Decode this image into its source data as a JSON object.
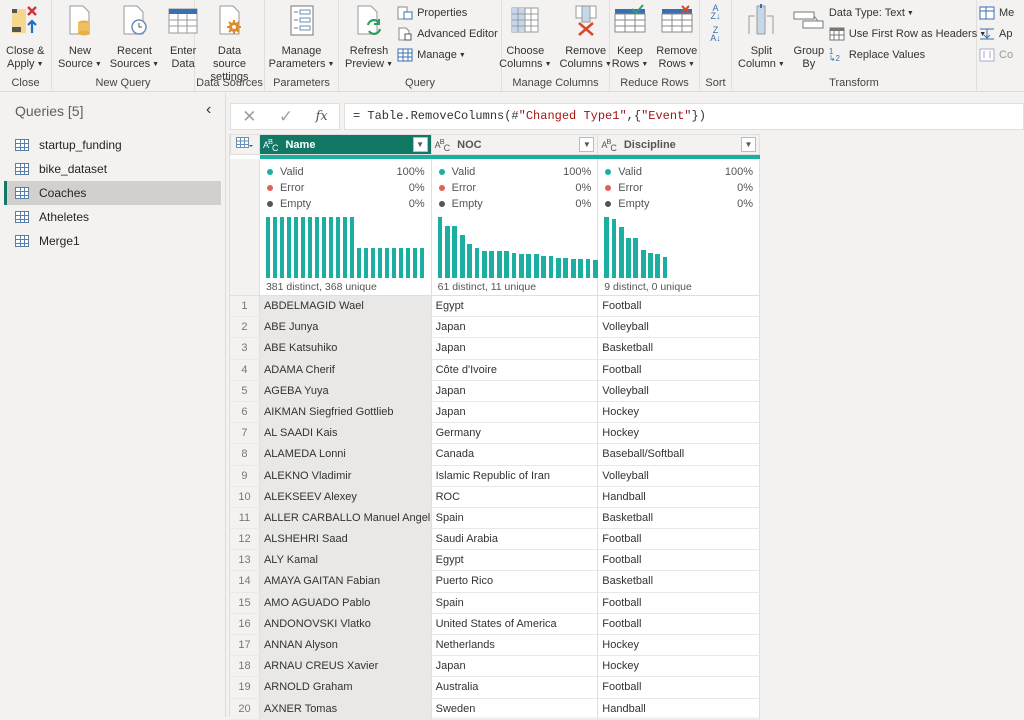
{
  "ribbon": {
    "groups": [
      {
        "label": "Close",
        "buttons": [
          {
            "label1": "Close &",
            "label2": "Apply",
            "caret": true
          }
        ]
      },
      {
        "label": "New Query",
        "buttons": [
          {
            "label1": "New",
            "label2": "Source",
            "caret": true
          },
          {
            "label1": "Recent",
            "label2": "Sources",
            "caret": true
          },
          {
            "label1": "Enter",
            "label2": "Data",
            "caret": false
          }
        ]
      },
      {
        "label": "Data Sources",
        "buttons": [
          {
            "label1": "Data source",
            "label2": "settings",
            "caret": false
          }
        ]
      },
      {
        "label": "Parameters",
        "buttons": [
          {
            "label1": "Manage",
            "label2": "Parameters",
            "caret": true
          }
        ]
      },
      {
        "label": "Query",
        "buttons": [
          {
            "label1": "Refresh",
            "label2": "Preview",
            "caret": true
          }
        ],
        "small": [
          {
            "label": "Properties"
          },
          {
            "label": "Advanced Editor"
          },
          {
            "label": "Manage",
            "caret": true
          }
        ]
      },
      {
        "label": "Manage Columns",
        "buttons": [
          {
            "label1": "Choose",
            "label2": "Columns",
            "caret": true
          },
          {
            "label1": "Remove",
            "label2": "Columns",
            "caret": true
          }
        ]
      },
      {
        "label": "Reduce Rows",
        "buttons": [
          {
            "label1": "Keep",
            "label2": "Rows",
            "caret": true
          },
          {
            "label1": "Remove",
            "label2": "Rows",
            "caret": true
          }
        ]
      },
      {
        "label": "Sort",
        "small": [
          {
            "label": "Sort Ascending"
          },
          {
            "label": "Sort Descending"
          }
        ]
      },
      {
        "label": "Transform",
        "buttons": [
          {
            "label1": "Split",
            "label2": "Column",
            "caret": true
          },
          {
            "label1": "Group",
            "label2": "By",
            "caret": false
          }
        ],
        "small": [
          {
            "label": "Data Type: Text",
            "caret": true
          },
          {
            "label": "Use First Row as Headers",
            "caret": true
          },
          {
            "label": "Replace Values"
          }
        ]
      },
      {
        "label": "",
        "small": [
          {
            "label": "Me"
          },
          {
            "label": "Ap"
          },
          {
            "label": "Co"
          }
        ]
      }
    ]
  },
  "queries": {
    "title": "Queries [5]",
    "items": [
      {
        "label": "startup_funding",
        "selected": false
      },
      {
        "label": "bike_dataset",
        "selected": false
      },
      {
        "label": "Coaches",
        "selected": true
      },
      {
        "label": "Atheletes",
        "selected": false
      },
      {
        "label": "Merge1",
        "selected": false
      }
    ]
  },
  "formula": {
    "cancel_icon": "✕",
    "commit_icon": "✓",
    "fx_label": "fx",
    "prefix": "= Table.RemoveColumns(#",
    "s1": "\"Changed Type1\"",
    "mid": ",{",
    "s2": "\"Event\"",
    "suffix": "})"
  },
  "columns": [
    {
      "name": "Name",
      "type": "ABC",
      "selected": true,
      "valid": "100%",
      "error": "0%",
      "empty": "0%",
      "distinct": "381 distinct, 368 unique"
    },
    {
      "name": "NOC",
      "type": "ABC",
      "selected": false,
      "valid": "100%",
      "error": "0%",
      "empty": "0%",
      "distinct": "61 distinct, 11 unique"
    },
    {
      "name": "Discipline",
      "type": "ABC",
      "selected": false,
      "valid": "100%",
      "error": "0%",
      "empty": "0%",
      "distinct": "9 distinct, 0 unique"
    }
  ],
  "quality_labels": {
    "valid": "Valid",
    "error": "Error",
    "empty": "Empty"
  },
  "colors": {
    "valid": "#1aafa0",
    "error": "#e0605a",
    "empty": "#555555",
    "accent": "#117865"
  },
  "histograms": [
    [
      2,
      2,
      2,
      2,
      2,
      2,
      2,
      2,
      2,
      2,
      2,
      2,
      2,
      1,
      1,
      1,
      1,
      1,
      1,
      1,
      1,
      1,
      1
    ],
    [
      100,
      85,
      85,
      70,
      55,
      49,
      44,
      44,
      44,
      44,
      41,
      39,
      39,
      39,
      36,
      36,
      33,
      33,
      31,
      31,
      31,
      29
    ],
    [
      100,
      96,
      83,
      66,
      66,
      46,
      41,
      40,
      35
    ]
  ],
  "rows": [
    [
      "1",
      "ABDELMAGID Wael",
      "Egypt",
      "Football"
    ],
    [
      "2",
      "ABE Junya",
      "Japan",
      "Volleyball"
    ],
    [
      "3",
      "ABE Katsuhiko",
      "Japan",
      "Basketball"
    ],
    [
      "4",
      "ADAMA Cherif",
      "Côte d'Ivoire",
      "Football"
    ],
    [
      "5",
      "AGEBA Yuya",
      "Japan",
      "Volleyball"
    ],
    [
      "6",
      "AIKMAN Siegfried Gottlieb",
      "Japan",
      "Hockey"
    ],
    [
      "7",
      "AL SAADI Kais",
      "Germany",
      "Hockey"
    ],
    [
      "8",
      "ALAMEDA Lonni",
      "Canada",
      "Baseball/Softball"
    ],
    [
      "9",
      "ALEKNO Vladimir",
      "Islamic Republic of Iran",
      "Volleyball"
    ],
    [
      "10",
      "ALEKSEEV Alexey",
      "ROC",
      "Handball"
    ],
    [
      "11",
      "ALLER CARBALLO Manuel Angel",
      "Spain",
      "Basketball"
    ],
    [
      "12",
      "ALSHEHRI Saad",
      "Saudi Arabia",
      "Football"
    ],
    [
      "13",
      "ALY Kamal",
      "Egypt",
      "Football"
    ],
    [
      "14",
      "AMAYA GAITAN Fabian",
      "Puerto Rico",
      "Basketball"
    ],
    [
      "15",
      "AMO AGUADO Pablo",
      "Spain",
      "Football"
    ],
    [
      "16",
      "ANDONOVSKI Vlatko",
      "United States of America",
      "Football"
    ],
    [
      "17",
      "ANNAN Alyson",
      "Netherlands",
      "Hockey"
    ],
    [
      "18",
      "ARNAU CREUS Xavier",
      "Japan",
      "Hockey"
    ],
    [
      "19",
      "ARNOLD Graham",
      "Australia",
      "Football"
    ],
    [
      "20",
      "AXNER Tomas",
      "Sweden",
      "Handball"
    ]
  ]
}
